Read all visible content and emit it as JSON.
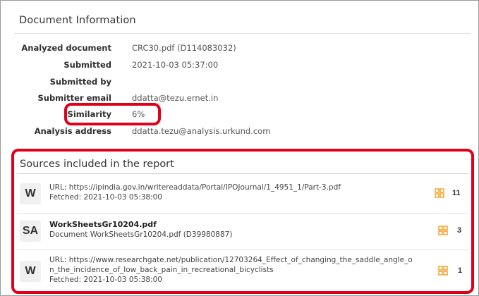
{
  "document_info": {
    "title": "Document Information",
    "rows": [
      {
        "label": "Analyzed document",
        "value": "CRC30.pdf (D114083032)"
      },
      {
        "label": "Submitted",
        "value": "2021-10-03 05:37:00"
      },
      {
        "label": "Submitted by",
        "value": ""
      },
      {
        "label": "Submitter email",
        "value": "ddatta@tezu.ernet.in"
      },
      {
        "label": "Similarity",
        "value": "6%"
      },
      {
        "label": "Analysis address",
        "value": "ddatta.tezu@analysis.urkund.com"
      }
    ]
  },
  "sources": {
    "title": "Sources included in the report",
    "icon": "grid-icon",
    "accent_color": "#f0a020",
    "highlight_color": "#e0001a",
    "items": [
      {
        "badge": "W",
        "line1": "URL: https://ipindia.gov.in/writereaddata/Portal/IPOJournal/1_4951_1/Part-3.pdf",
        "line2": "Fetched: 2021-10-03 05:38:00",
        "count": "11"
      },
      {
        "badge": "SA",
        "name": "WorkSheetsGr10204.pdf",
        "line1": "Document WorkSheetsGr10204.pdf (D39980887)",
        "count": "3"
      },
      {
        "badge": "W",
        "line1": "URL: https://www.researchgate.net/publication/12703264_Effect_of_changing_the_saddle_angle_o",
        "line2": "n_the_incidence_of_low_back_pain_in_recreational_bicyclists",
        "line3": "Fetched: 2021-10-03 05:38:00",
        "count": "1"
      }
    ]
  }
}
